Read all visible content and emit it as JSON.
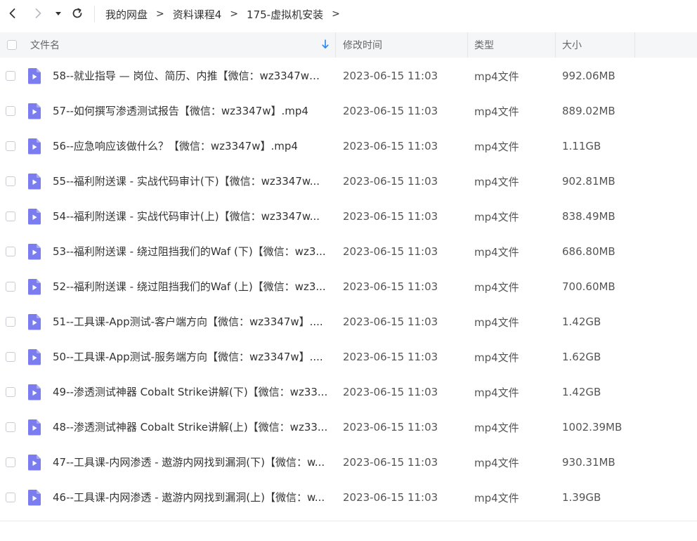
{
  "toolbar": {
    "back_icon": "back-arrow-icon",
    "forward_icon": "forward-arrow-icon",
    "dropdown_icon": "caret-down-icon",
    "refresh_icon": "refresh-icon"
  },
  "breadcrumb": {
    "items": [
      "我的网盘",
      "资料课程4",
      "175-虚拟机安装"
    ],
    "separator": ">"
  },
  "table": {
    "columns": {
      "name": "文件名",
      "modified": "修改时间",
      "type": "类型",
      "size": "大小"
    },
    "sort_icon": "sort-down-arrow-icon",
    "rows": [
      {
        "name": "58--就业指导 — 岗位、简历、内推【微信：wz3347w】...",
        "modified": "2023-06-15 11:03",
        "type": "mp4文件",
        "size": "992.06MB"
      },
      {
        "name": "57--如何撰写渗透测试报告【微信：wz3347w】.mp4",
        "modified": "2023-06-15 11:03",
        "type": "mp4文件",
        "size": "889.02MB"
      },
      {
        "name": "56--应急响应该做什么？【微信：wz3347w】.mp4",
        "modified": "2023-06-15 11:03",
        "type": "mp4文件",
        "size": "1.11GB"
      },
      {
        "name": "55--福利附送课 - 实战代码审计(下)【微信：wz3347w...",
        "modified": "2023-06-15 11:03",
        "type": "mp4文件",
        "size": "902.81MB"
      },
      {
        "name": "54--福利附送课 - 实战代码审计(上)【微信：wz3347w...",
        "modified": "2023-06-15 11:03",
        "type": "mp4文件",
        "size": "838.49MB"
      },
      {
        "name": "53--福利附送课 - 绕过阻挡我们的Waf (下)【微信：wz3...",
        "modified": "2023-06-15 11:03",
        "type": "mp4文件",
        "size": "686.80MB"
      },
      {
        "name": "52--福利附送课 - 绕过阻挡我们的Waf (上)【微信：wz3...",
        "modified": "2023-06-15 11:03",
        "type": "mp4文件",
        "size": "700.60MB"
      },
      {
        "name": "51--工具课-App测试-客户端方向【微信：wz3347w】....",
        "modified": "2023-06-15 11:03",
        "type": "mp4文件",
        "size": "1.42GB"
      },
      {
        "name": "50--工具课-App测试-服务端方向【微信：wz3347w】....",
        "modified": "2023-06-15 11:03",
        "type": "mp4文件",
        "size": "1.62GB"
      },
      {
        "name": "49--渗透测试神器 Cobalt Strike讲解(下)【微信：wz33...",
        "modified": "2023-06-15 11:03",
        "type": "mp4文件",
        "size": "1.42GB"
      },
      {
        "name": "48--渗透测试神器 Cobalt Strike讲解(上)【微信：wz33...",
        "modified": "2023-06-15 11:03",
        "type": "mp4文件",
        "size": "1002.39MB"
      },
      {
        "name": "47--工具课-内网渗透 - 遨游内网找到漏洞(下)【微信：w...",
        "modified": "2023-06-15 11:03",
        "type": "mp4文件",
        "size": "930.31MB"
      },
      {
        "name": "46--工具课-内网渗透 - 遨游内网找到漏洞(上)【微信：w...",
        "modified": "2023-06-15 11:03",
        "type": "mp4文件",
        "size": "1.39GB"
      }
    ],
    "file_icon": "video-file-icon",
    "checkbox_icon": "checkbox-icon"
  },
  "colors": {
    "accent": "#2a86f0",
    "file_icon": "#7b7cf0",
    "header_bg": "#f5f6f8"
  }
}
